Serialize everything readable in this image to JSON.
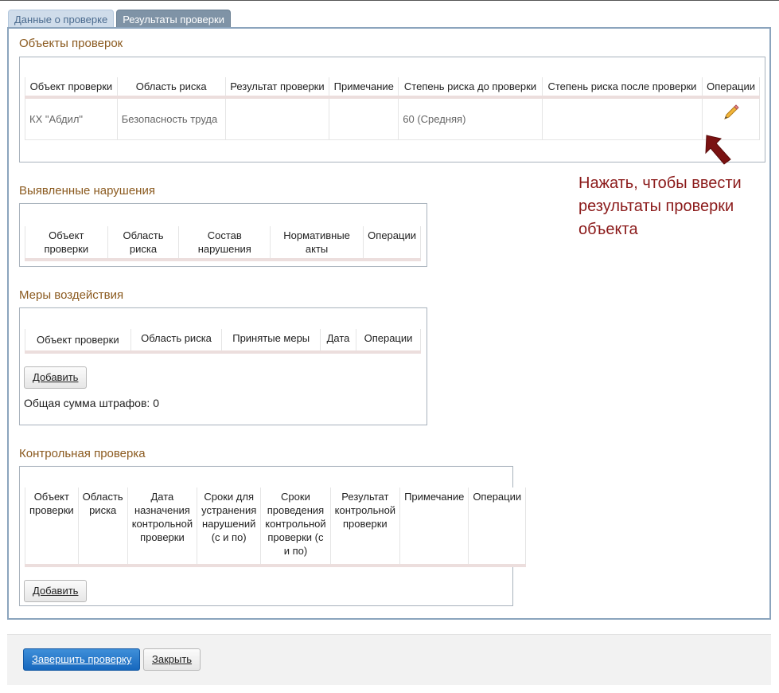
{
  "tabs": [
    {
      "label": "Данные о проверке",
      "active": false
    },
    {
      "label": "Результаты проверки",
      "active": true
    }
  ],
  "objects_section": {
    "title": "Объекты проверок",
    "columns": [
      "Объект проверки",
      "Область риска",
      "Результат проверки",
      "Примечание",
      "Степень риска до проверки",
      "Степень риска после проверки",
      "Операции"
    ],
    "rows": [
      {
        "object": "КХ \"Абдил\"",
        "risk_area": "Безопасность труда",
        "result": "",
        "note": "",
        "risk_before": "60 (Средняя)",
        "risk_after": "",
        "operation_icon": "pencil-icon"
      }
    ]
  },
  "annotation": {
    "text": "Нажать, чтобы ввести результаты проверки объекта",
    "color": "#8b1a1a"
  },
  "violations_section": {
    "title": "Выявленные нарушения",
    "columns": [
      "Объект проверки",
      "Область риска",
      "Состав нарушения",
      "Нормативные акты",
      "Операции"
    ]
  },
  "measures_section": {
    "title": "Меры воздействия",
    "columns": [
      "Объект проверки",
      "Область риска",
      "Принятые меры",
      "Дата",
      "Операции"
    ],
    "add_button": "Добавить",
    "total_fines": "Общая сумма штрафов: 0"
  },
  "control_section": {
    "title": "Контрольная проверка",
    "columns": [
      "Объект проверки",
      "Область риска",
      "Дата назначения контрольной проверки",
      "Сроки для устранения нарушений (с и по)",
      "Сроки проведения контрольной проверки (с и по)",
      "Результат контрольной проверки",
      "Примечание",
      "Операции"
    ],
    "add_button": "Добавить"
  },
  "footer": {
    "finish_button": "Завершить проверку",
    "close_button": "Закрыть"
  },
  "colors": {
    "section_title": "#8b5a1f",
    "primary_button": "#1f74c9",
    "tab_active": "#7f93a6",
    "tab_inactive": "#cfdcea",
    "panel_border": "#8ba4bd"
  }
}
